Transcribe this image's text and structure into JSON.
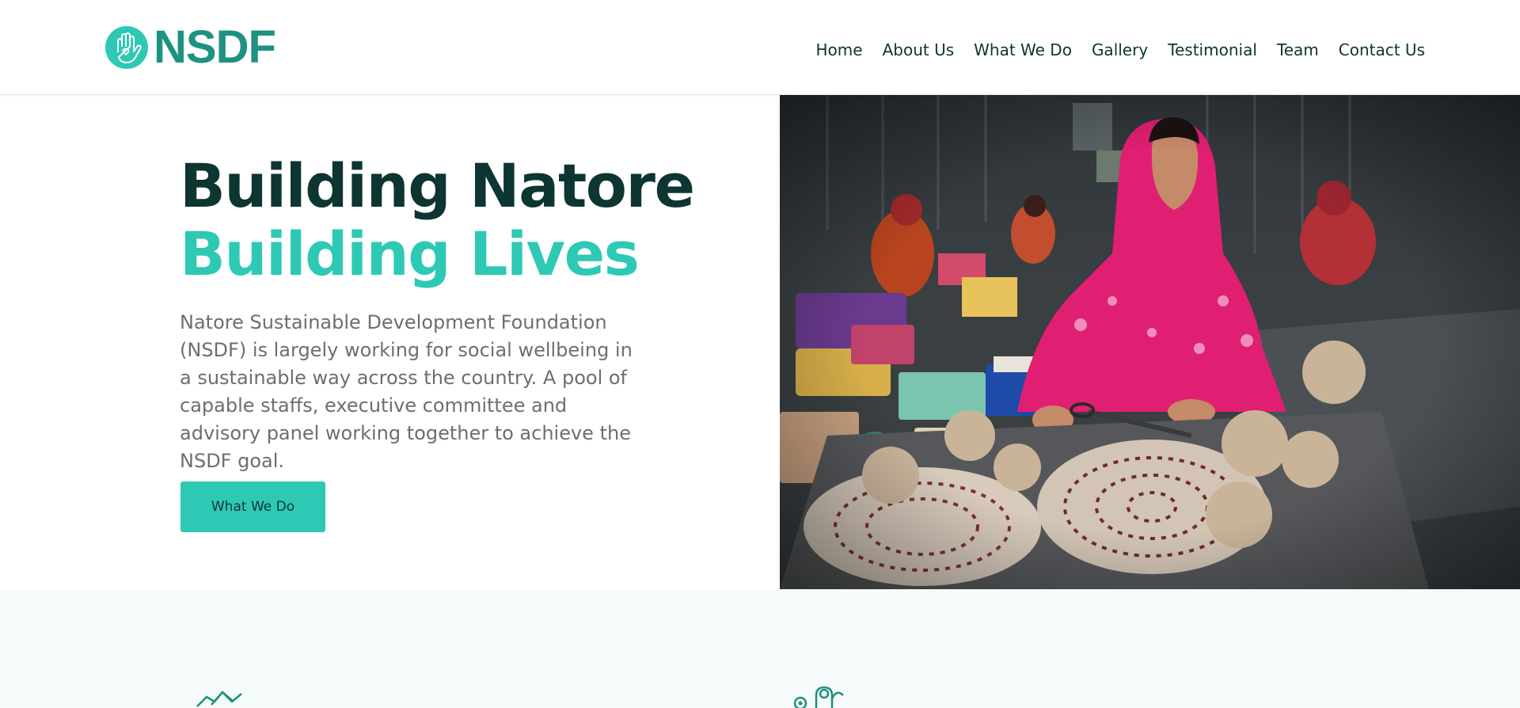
{
  "brand": {
    "name": "NSDF",
    "logo_icon": "hand-heart-logo-icon",
    "primary_color": "#2ec9b5",
    "dark_color": "#1f9182",
    "text_color": "#0d3532"
  },
  "nav": {
    "items": [
      {
        "label": "Home"
      },
      {
        "label": "About Us"
      },
      {
        "label": "What We Do"
      },
      {
        "label": "Gallery"
      },
      {
        "label": "Testimonial"
      },
      {
        "label": "Team"
      },
      {
        "label": "Contact Us"
      }
    ]
  },
  "hero": {
    "title_line1": "Building Natore",
    "title_line2": "Building Lives",
    "description": "Natore Sustainable Development Foundation (NSDF) is largely working for social wellbeing in a sustainable way across the country. A pool of capable staffs, executive committee and advisory panel working together to achieve the NSDF goal.",
    "cta_label": "What We Do",
    "image_icon": "woman-weaving-baskets-photo"
  },
  "features": {
    "items": [
      {
        "icon": "handshake-icon"
      },
      {
        "icon": "people-target-icon"
      }
    ]
  }
}
